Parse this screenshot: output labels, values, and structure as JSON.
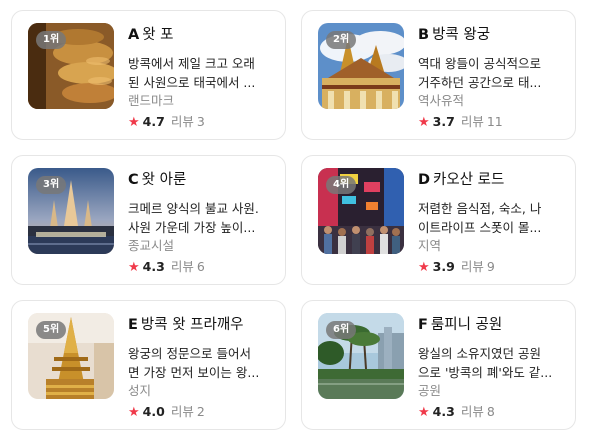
{
  "cards": [
    {
      "rank": "1위",
      "letter": "A",
      "name": "왓 포",
      "desc_line1": "방콕에서 제일 크고 오래",
      "desc_line2": "된 사원으로 태국에서 ...",
      "category": "랜드마크",
      "score": "4.7",
      "review_label": "리뷰",
      "review_count": "3",
      "thumb": "golden-buddha-image"
    },
    {
      "rank": "2위",
      "letter": "B",
      "name": "방콕 왕궁",
      "desc_line1": "역대 왕들이 공식적으로",
      "desc_line2": "거주하던 공간으로 태...",
      "category": "역사유적",
      "score": "3.7",
      "review_label": "리뷰",
      "review_count": "11",
      "thumb": "grand-palace-image"
    },
    {
      "rank": "3위",
      "letter": "C",
      "name": "왓 아룬",
      "desc_line1": "크메르 양식의 불교 사원.",
      "desc_line2": "사원 가운데 가장 높이...",
      "category": "종교시설",
      "score": "4.3",
      "review_label": "리뷰",
      "review_count": "6",
      "thumb": "wat-arun-image"
    },
    {
      "rank": "4위",
      "letter": "D",
      "name": "카오산 로드",
      "desc_line1": "저렴한 음식점, 숙소, 나",
      "desc_line2": "이트라이프 스폿이 몰...",
      "category": "지역",
      "score": "3.9",
      "review_label": "리뷰",
      "review_count": "9",
      "thumb": "khao-san-road-image"
    },
    {
      "rank": "5위",
      "letter": "E",
      "name": "방콕 왓 프라깨우",
      "desc_line1": "왕궁의 정문으로 들어서",
      "desc_line2": "면 가장 먼저 보이는 왕...",
      "category": "성지",
      "score": "4.0",
      "review_label": "리뷰",
      "review_count": "2",
      "thumb": "golden-stupa-image"
    },
    {
      "rank": "6위",
      "letter": "F",
      "name": "룸피니 공원",
      "desc_line1": "왕실의 소유지였던 공원",
      "desc_line2": "으로 '방콕의 폐'와도 같...",
      "category": "공원",
      "score": "4.3",
      "review_label": "리뷰",
      "review_count": "8",
      "thumb": "lumpini-park-image"
    }
  ]
}
